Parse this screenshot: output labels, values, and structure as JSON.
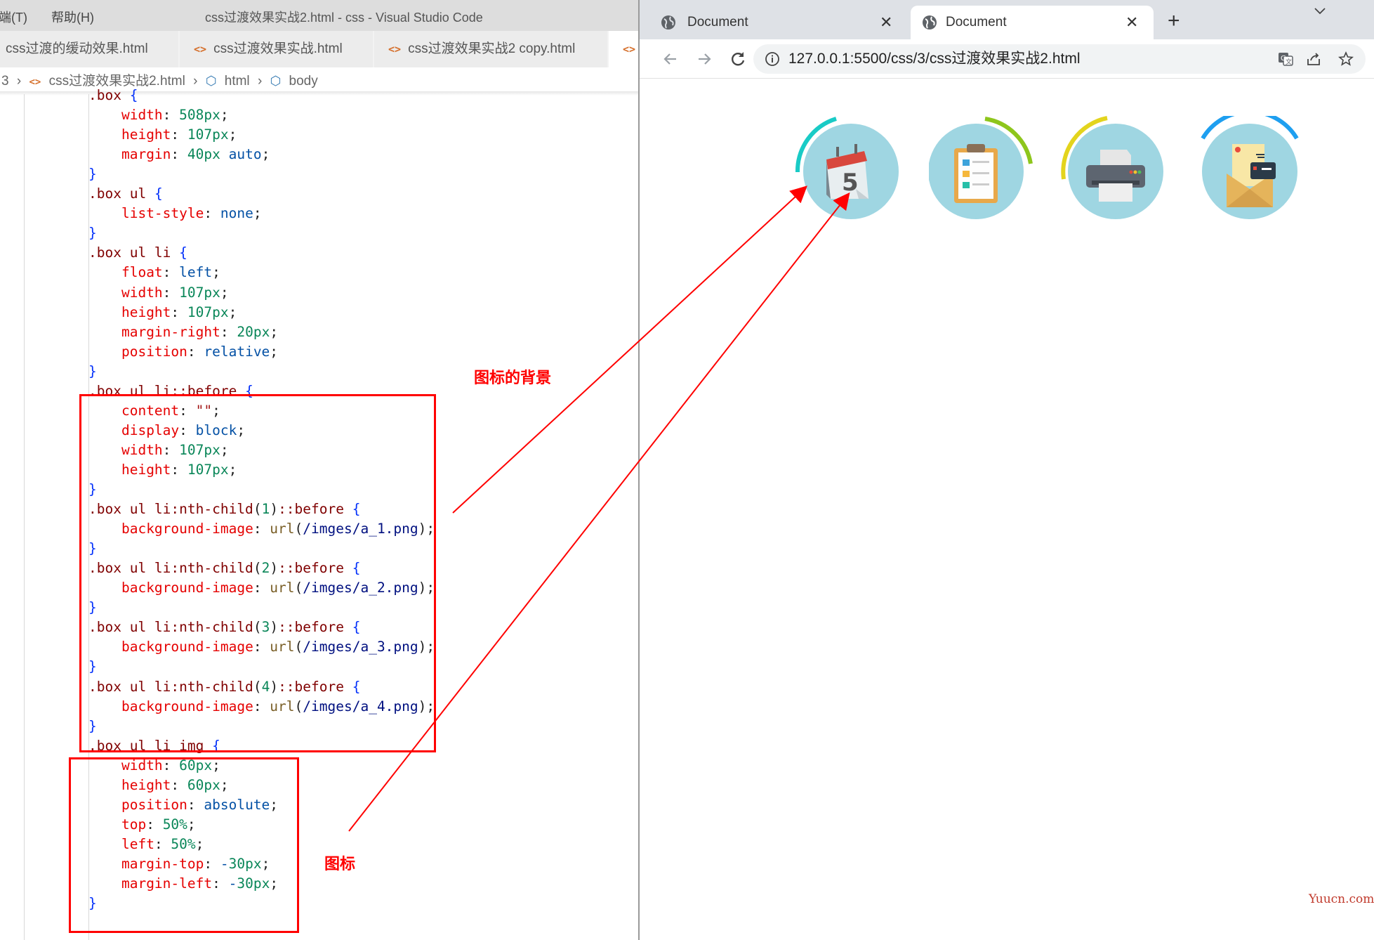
{
  "vscode": {
    "menu": [
      "终端(T)",
      "帮助(H)"
    ],
    "window_title": "css过渡效果实战2.html - css - Visual Studio Code",
    "tabs": [
      "css过渡的缓动效果.html",
      "css过渡效果实战.html",
      "css过渡效果实战2 copy.html"
    ],
    "breadcrumb": [
      "3",
      "css过渡效果实战2.html",
      "html",
      "body"
    ],
    "code_lines": [
      ".box {",
      "    width: 508px;",
      "    height: 107px;",
      "    margin: 40px auto;",
      "}",
      ".box ul {",
      "    list-style: none;",
      "}",
      ".box ul li {",
      "    float: left;",
      "    width: 107px;",
      "    height: 107px;",
      "    margin-right: 20px;",
      "    position: relative;",
      "}",
      ".box ul li::before {",
      "    content: \"\";",
      "    display: block;",
      "    width: 107px;",
      "    height: 107px;",
      "}",
      ".box ul li:nth-child(1)::before {",
      "    background-image: url(/imges/a_1.png);",
      "}",
      ".box ul li:nth-child(2)::before {",
      "    background-image: url(/imges/a_2.png);",
      "}",
      ".box ul li:nth-child(3)::before {",
      "    background-image: url(/imges/a_3.png);",
      "}",
      ".box ul li:nth-child(4)::before {",
      "    background-image: url(/imges/a_4.png);",
      "}",
      ".box ul li img {",
      "    width: 60px;",
      "    height: 60px;",
      "    position: absolute;",
      "    top: 50%;",
      "    left: 50%;",
      "    margin-top: -30px;",
      "    margin-left: -30px;",
      "}"
    ],
    "annotations": {
      "background_note": "图标的背景",
      "icon_note": "图标"
    }
  },
  "browser": {
    "tabs": [
      {
        "label": "Document",
        "active": false
      },
      {
        "label": "Document",
        "active": true
      }
    ],
    "new_tab_symbol": "+",
    "url": "127.0.0.1:5500/css/3/css过渡效果实战2.html",
    "icons": [
      {
        "name": "calendar-icon",
        "arc_color": "#19cbc6"
      },
      {
        "name": "clipboard-icon",
        "arc_color": "#8ec61c"
      },
      {
        "name": "printer-icon",
        "arc_color": "#e3d41d"
      },
      {
        "name": "mail-icon",
        "arc_color": "#1e9ff0"
      }
    ],
    "calendar_day": "5",
    "watermark": "Yuucn.com"
  },
  "colors": {
    "circle_bg": "#9fd6e2",
    "annotation_red": "#ff0000"
  }
}
